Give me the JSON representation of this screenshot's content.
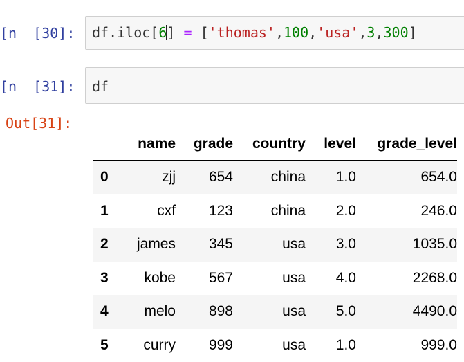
{
  "cells": [
    {
      "prompt": "[n  [30]:",
      "code_tokens": {
        "t1": "df.iloc",
        "t2": "[",
        "t3": "6",
        "t4": "]",
        "t5": " = ",
        "t6": "[",
        "t7": "'thomas'",
        "t8": ",",
        "t9": "100",
        "t10": ",",
        "t11": "'usa'",
        "t12": ",",
        "t13": "3",
        "t14": ",",
        "t15": "300",
        "t16": "]"
      }
    },
    {
      "prompt": "[n  [31]:",
      "code": "df"
    }
  ],
  "output": {
    "prompt": "Out[31]:",
    "table": {
      "columns": [
        "name",
        "grade",
        "country",
        "level",
        "grade_level"
      ],
      "rows": [
        {
          "index": "0",
          "name": "zjj",
          "grade": "654",
          "country": "china",
          "level": "1.0",
          "grade_level": "654.0"
        },
        {
          "index": "1",
          "name": "cxf",
          "grade": "123",
          "country": "china",
          "level": "2.0",
          "grade_level": "246.0"
        },
        {
          "index": "2",
          "name": "james",
          "grade": "345",
          "country": "usa",
          "level": "3.0",
          "grade_level": "1035.0"
        },
        {
          "index": "3",
          "name": "kobe",
          "grade": "567",
          "country": "usa",
          "level": "4.0",
          "grade_level": "2268.0"
        },
        {
          "index": "4",
          "name": "melo",
          "grade": "898",
          "country": "usa",
          "level": "5.0",
          "grade_level": "4490.0"
        },
        {
          "index": "5",
          "name": "curry",
          "grade": "999",
          "country": "usa",
          "level": "1.0",
          "grade_level": "999.0"
        }
      ]
    }
  },
  "colors": {
    "input_prompt": "#303f9f",
    "output_prompt": "#d84315",
    "string": "#ba2121",
    "number": "#008000",
    "operator": "#aa22ff",
    "cell_background": "#f7f7f7",
    "selected_cell_border": "#66bb6a"
  }
}
